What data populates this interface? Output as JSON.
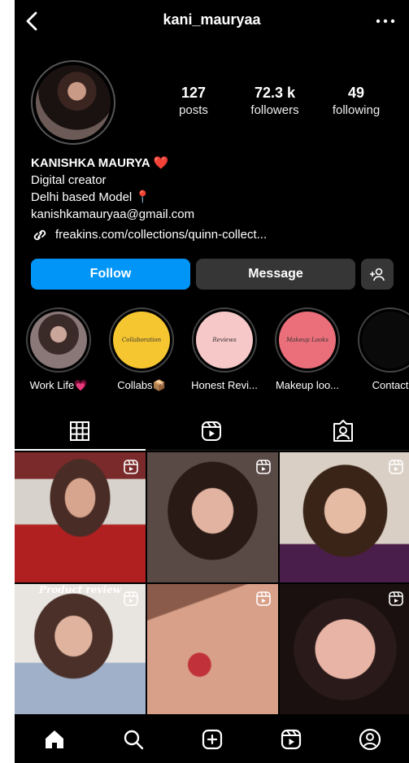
{
  "header": {
    "username": "kani_mauryaa",
    "back_icon": "chevron-left-icon",
    "more_icon": "more-horizontal-icon"
  },
  "profile": {
    "stats": [
      {
        "value": "127",
        "label": "posts"
      },
      {
        "value": "72.3 k",
        "label": "followers"
      },
      {
        "value": "49",
        "label": "following"
      }
    ],
    "name": "KANISHKA MAURYA",
    "name_emoji": "❤️",
    "category": "Digital creator",
    "bio_line": "Delhi based Model",
    "bio_emoji": "📍",
    "email": "kanishkamauryaa@gmail.com",
    "link": "freakins.com/collections/quinn-collect..."
  },
  "actions": {
    "follow_label": "Follow",
    "message_label": "Message",
    "add_user_icon": "add-user-icon"
  },
  "highlights": [
    {
      "label": "Work Life💗",
      "cover_text": "",
      "color": "#8a6a6a"
    },
    {
      "label": "Collabs📦",
      "cover_text": "Collaboration",
      "color": "#f6c630"
    },
    {
      "label": "Honest Revi...",
      "cover_text": "Reviews",
      "color": "#f7c8c8"
    },
    {
      "label": "Makeup loo...",
      "cover_text": "Makeup Looks",
      "color": "#ea6f7a"
    },
    {
      "label": "Contact",
      "cover_text": "",
      "color": "#0a0a0a"
    }
  ],
  "tabs": [
    "grid-icon",
    "reels-icon",
    "tagged-icon"
  ],
  "posts": [
    {
      "overlay": "",
      "is_reel": true
    },
    {
      "overlay": "",
      "is_reel": true
    },
    {
      "overlay": "",
      "is_reel": true
    },
    {
      "overlay": "Product review",
      "is_reel": true
    },
    {
      "overlay": "",
      "is_reel": true
    },
    {
      "overlay": "",
      "is_reel": true
    }
  ],
  "bottom_nav": [
    "home-icon",
    "search-icon",
    "create-icon",
    "reels-icon",
    "profile-icon"
  ],
  "colors": {
    "accent": "#0095f6",
    "button_gray": "#363636",
    "background": "#000000"
  }
}
